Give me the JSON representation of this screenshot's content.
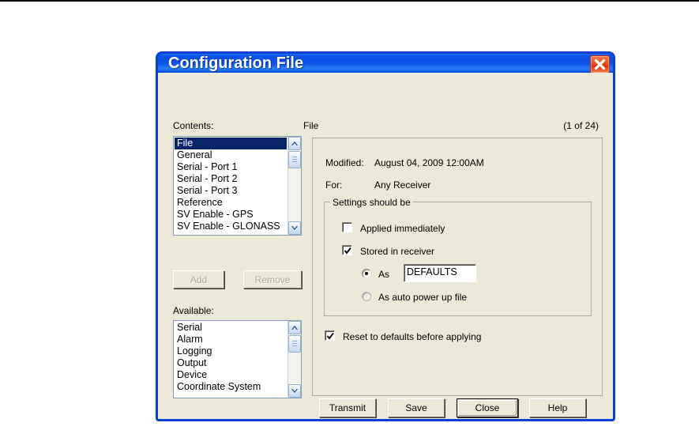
{
  "window": {
    "title": "Configuration File",
    "close_icon": "close-icon"
  },
  "left_panel": {
    "contents_label": "Contents:",
    "contents_items": [
      "File",
      "General",
      "Serial - Port 1",
      "Serial - Port 2",
      "Serial - Port 3",
      "Reference",
      "SV Enable - GPS",
      "SV Enable - GLONASS"
    ],
    "contents_selected": "File",
    "add_label": "Add",
    "remove_label": "Remove",
    "available_label": "Available:",
    "available_items": [
      "Serial",
      "Alarm",
      "Logging",
      "Output",
      "Device",
      "Coordinate System"
    ]
  },
  "right_panel": {
    "section_title": "File",
    "page_counter": "(1 of 24)",
    "modified_label": "Modified:",
    "modified_value": "August 04, 2009 12:00AM",
    "for_label": "For:",
    "for_value": "Any Receiver",
    "group_title": "Settings should be",
    "applied_immediately_label": "Applied immediately",
    "applied_immediately_checked": false,
    "stored_in_receiver_label": "Stored in receiver",
    "stored_in_receiver_checked": true,
    "as_label": "As",
    "as_selected": true,
    "as_value": "DEFAULTS",
    "as_auto_power_label": "As auto power up file",
    "as_auto_power_selected": false,
    "reset_defaults_label": "Reset to defaults before applying",
    "reset_defaults_checked": true
  },
  "footer": {
    "transmit_label": "Transmit",
    "save_label": "Save",
    "close_label": "Close",
    "help_label": "Help"
  },
  "colors": {
    "title_blue": "#0b4de6",
    "dialog_face": "#ece9d8",
    "selection_blue": "#0a246a",
    "close_red": "#e8562a"
  }
}
